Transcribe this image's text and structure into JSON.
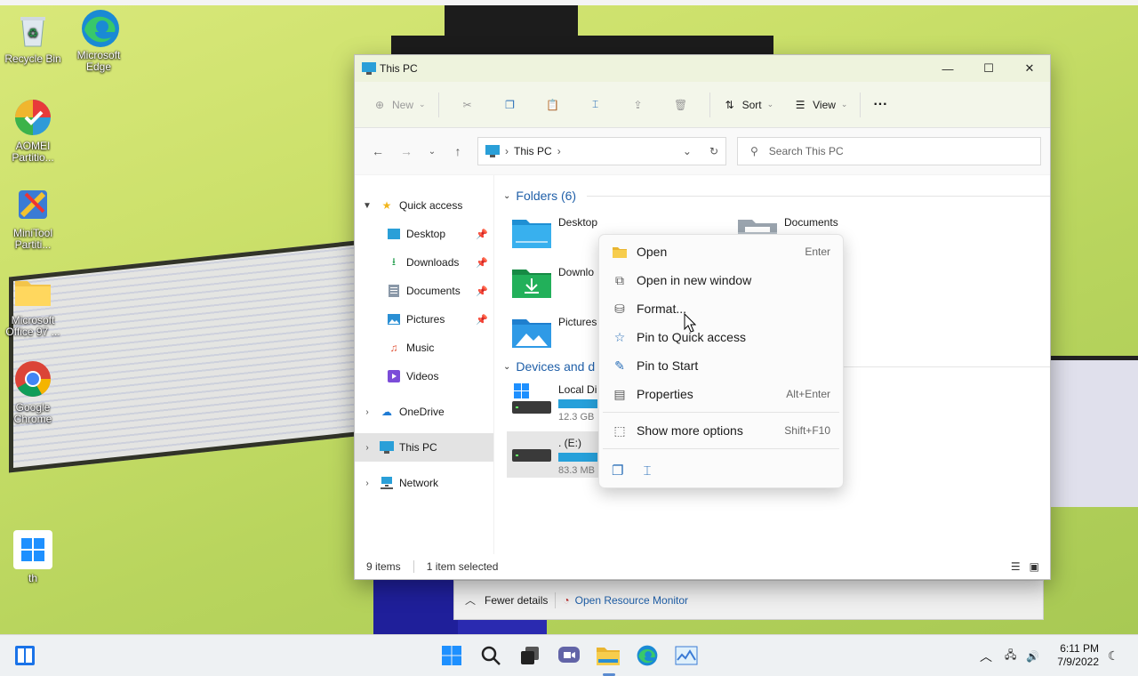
{
  "desktop": {
    "icons": [
      {
        "label": "Recycle Bin",
        "icon": "recycle-bin-icon"
      },
      {
        "label": "Microsoft Edge",
        "icon": "edge-icon"
      },
      {
        "label": "AOMEI Partitio...",
        "icon": "aomei-icon"
      },
      {
        "label": "MiniTool Partiti...",
        "icon": "minitool-icon"
      },
      {
        "label": "Microsoft Office 97 ...",
        "icon": "folder-icon"
      },
      {
        "label": "Google Chrome",
        "icon": "chrome-icon"
      },
      {
        "label": "th",
        "icon": "windows-logo-icon"
      }
    ]
  },
  "window": {
    "title": "This PC",
    "controls": {
      "minimize": "minimize-icon",
      "maximize": "maximize-icon",
      "close": "close-icon"
    }
  },
  "toolbar": {
    "new_label": "New",
    "sort_label": "Sort",
    "view_label": "View",
    "more_label": "···"
  },
  "navbar": {
    "breadcrumb": "This PC",
    "search_placeholder": "Search This PC"
  },
  "sidebar": {
    "quick_access": "Quick access",
    "items": [
      {
        "label": "Desktop",
        "pinned": true
      },
      {
        "label": "Downloads",
        "pinned": true
      },
      {
        "label": "Documents",
        "pinned": true
      },
      {
        "label": "Pictures",
        "pinned": true
      },
      {
        "label": "Music",
        "pinned": false
      },
      {
        "label": "Videos",
        "pinned": false
      }
    ],
    "onedrive": "OneDrive",
    "this_pc": "This PC",
    "network": "Network"
  },
  "content": {
    "folders_header": "Folders (6)",
    "folders": [
      "Desktop",
      "Documents",
      "Downlo",
      "Pictures"
    ],
    "devices_header": "Devices and d",
    "drives": [
      {
        "name": "Local Di",
        "free": "12.3 GB",
        "used_fraction": 0.4
      },
      {
        "name": ". (E:)",
        "free": "83.3 MB",
        "used_fraction": 0.4
      }
    ]
  },
  "status": {
    "items": "9 items",
    "selected": "1 item selected"
  },
  "context_menu": {
    "items": [
      {
        "label": "Open",
        "shortcut": "Enter"
      },
      {
        "label": "Open in new window",
        "shortcut": ""
      },
      {
        "label": "Format...",
        "shortcut": ""
      },
      {
        "label": "Pin to Quick access",
        "shortcut": ""
      },
      {
        "label": "Pin to Start",
        "shortcut": ""
      },
      {
        "label": "Properties",
        "shortcut": "Alt+Enter"
      }
    ],
    "more": {
      "label": "Show more options",
      "shortcut": "Shift+F10"
    }
  },
  "taskmgr_strip": {
    "fewer_details": "Fewer details",
    "resource_monitor": "Open Resource Monitor"
  },
  "taskbar": {
    "time": "6:11 PM",
    "date": "7/9/2022"
  },
  "colors": {
    "accent": "#0067c0",
    "link": "#1f5fa8",
    "drive_bar": "#26a0da"
  }
}
